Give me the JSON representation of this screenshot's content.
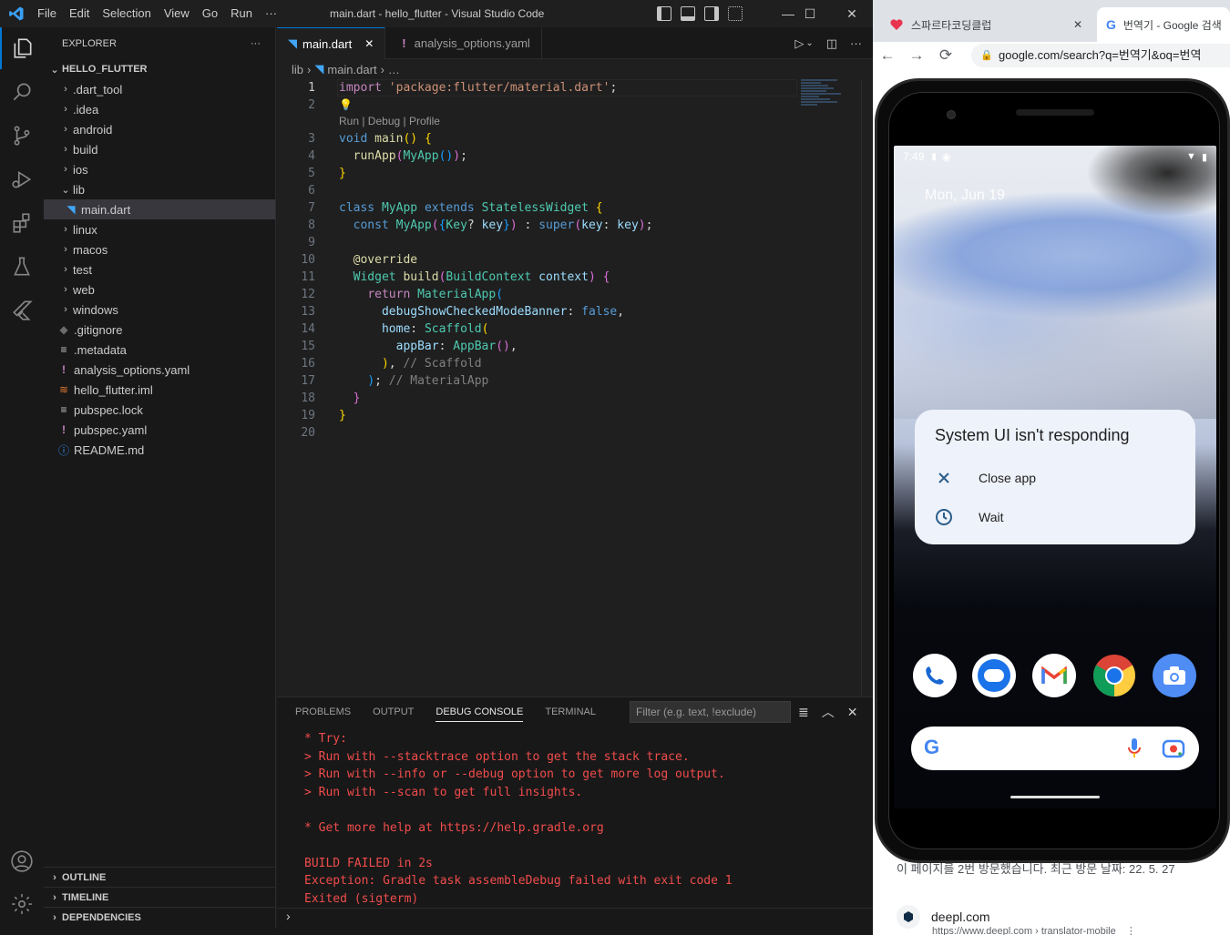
{
  "vscode": {
    "menu": [
      "File",
      "Edit",
      "Selection",
      "View",
      "Go",
      "Run",
      "···"
    ],
    "window_title": "main.dart - hello_flutter - Visual Studio Code",
    "window_controls": {
      "minimize": "—",
      "maximize": "☐",
      "close": "✕"
    },
    "activity_icons": [
      "explorer-icon",
      "search-icon",
      "source-control-icon",
      "run-debug-icon",
      "extensions-icon",
      "testing-icon",
      "flutter-icon",
      "account-icon",
      "settings-gear-icon"
    ],
    "sidebar": {
      "header": "EXPLORER",
      "more": "···",
      "root": "HELLO_FLUTTER",
      "items": [
        {
          "label": ".dart_tool",
          "type": "folder",
          "icon": "›"
        },
        {
          "label": ".idea",
          "type": "folder",
          "icon": "›"
        },
        {
          "label": "android",
          "type": "folder",
          "icon": "›"
        },
        {
          "label": "build",
          "type": "folder",
          "icon": "›"
        },
        {
          "label": "ios",
          "type": "folder",
          "icon": "›"
        },
        {
          "label": "lib",
          "type": "folder-open",
          "icon": "⌄"
        },
        {
          "label": "main.dart",
          "type": "dart",
          "icon": "◥",
          "selected": true
        },
        {
          "label": "linux",
          "type": "folder",
          "icon": "›"
        },
        {
          "label": "macos",
          "type": "folder",
          "icon": "›"
        },
        {
          "label": "test",
          "type": "folder",
          "icon": "›"
        },
        {
          "label": "web",
          "type": "folder",
          "icon": "›"
        },
        {
          "label": "windows",
          "type": "folder",
          "icon": "›"
        },
        {
          "label": ".gitignore",
          "type": "git",
          "icon": "◆"
        },
        {
          "label": ".metadata",
          "type": "text",
          "icon": "≡"
        },
        {
          "label": "analysis_options.yaml",
          "type": "yaml",
          "icon": "!"
        },
        {
          "label": "hello_flutter.iml",
          "type": "rss",
          "icon": "≋"
        },
        {
          "label": "pubspec.lock",
          "type": "text",
          "icon": "≡"
        },
        {
          "label": "pubspec.yaml",
          "type": "yaml",
          "icon": "!"
        },
        {
          "label": "README.md",
          "type": "info",
          "icon": "ⓘ"
        }
      ],
      "sections": [
        "OUTLINE",
        "TIMELINE",
        "DEPENDENCIES"
      ],
      "section_chevron": "›"
    },
    "tabs": [
      {
        "label": "main.dart",
        "icon": "◥",
        "active": true,
        "close": "✕"
      },
      {
        "label": "analysis_options.yaml",
        "icon": "!",
        "active": false
      }
    ],
    "tab_actions": [
      "▷",
      "⌄",
      "◫",
      "···"
    ],
    "breadcrumb": {
      "folder": "lib",
      "sep": "›",
      "icon": "◥",
      "file": "main.dart",
      "rest": "…"
    },
    "codelens": "Run | Debug | Profile",
    "lightbulb": "💡",
    "code_lines": [
      {
        "n": "1",
        "html": "<span class=\"k-purple\">import</span> <span class=\"k-str\">'package:flutter/material.dart'</span>;"
      },
      {
        "n": "2",
        "html": ""
      },
      {
        "n": "3",
        "html": "<span class=\"k-blue\">void</span> <span class=\"k-fn\">main</span><span class=\"k-br1\">()</span> <span class=\"k-br1\">{</span>"
      },
      {
        "n": "4",
        "html": "  <span class=\"k-fn\">runApp</span><span class=\"k-br2\">(</span><span class=\"k-type\">MyApp</span><span class=\"k-br3\">()</span><span class=\"k-br2\">)</span>;"
      },
      {
        "n": "5",
        "html": "<span class=\"k-br1\">}</span>"
      },
      {
        "n": "6",
        "html": ""
      },
      {
        "n": "7",
        "html": "<span class=\"k-blue\">class</span> <span class=\"k-type\">MyApp</span> <span class=\"k-blue\">extends</span> <span class=\"k-type\">StatelessWidget</span> <span class=\"k-br1\">{</span>"
      },
      {
        "n": "8",
        "html": "  <span class=\"k-blue\">const</span> <span class=\"k-type\">MyApp</span><span class=\"k-br2\">(</span><span class=\"k-br3\">{</span><span class=\"k-type\">Key</span>? <span class=\"k-var\">key</span><span class=\"k-br3\">}</span><span class=\"k-br2\">)</span> : <span class=\"k-blue\">super</span><span class=\"k-br2\">(</span><span class=\"k-var\">key</span>: <span class=\"k-var\">key</span><span class=\"k-br2\">)</span>;"
      },
      {
        "n": "9",
        "html": ""
      },
      {
        "n": "10",
        "html": "  <span class=\"k-fn\">@override</span>"
      },
      {
        "n": "11",
        "html": "  <span class=\"k-type\">Widget</span> <span class=\"k-fn\">build</span><span class=\"k-br2\">(</span><span class=\"k-type\">BuildContext</span> <span class=\"k-var\">context</span><span class=\"k-br2\">)</span> <span class=\"k-br2\">{</span>"
      },
      {
        "n": "12",
        "html": "    <span class=\"k-purple\">return</span> <span class=\"k-type\">MaterialApp</span><span class=\"k-br3\">(</span>"
      },
      {
        "n": "13",
        "html": "      <span class=\"k-var\">debugShowCheckedModeBanner</span>: <span class=\"k-blue\">false</span>,"
      },
      {
        "n": "14",
        "html": "      <span class=\"k-var\">home</span>: <span class=\"k-type\">Scaffold</span><span class=\"k-br1\">(</span>"
      },
      {
        "n": "15",
        "html": "        <span class=\"k-var\">appBar</span>: <span class=\"k-type\">AppBar</span><span class=\"k-br2\">()</span>,"
      },
      {
        "n": "16",
        "html": "      <span class=\"k-br1\">)</span>, <span class=\"k-cmt\">// Scaffold</span>"
      },
      {
        "n": "17",
        "html": "    <span class=\"k-br3\">)</span>; <span class=\"k-cmt\">// MaterialApp</span>"
      },
      {
        "n": "18",
        "html": "  <span class=\"k-br2\">}</span>"
      },
      {
        "n": "19",
        "html": "<span class=\"k-br1\">}</span>"
      },
      {
        "n": "20",
        "html": ""
      }
    ],
    "panel": {
      "tabs": [
        "PROBLEMS",
        "OUTPUT",
        "DEBUG CONSOLE",
        "TERMINAL"
      ],
      "active_tab": "DEBUG CONSOLE",
      "filter_placeholder": "Filter (e.g. text, !exclude)",
      "actions": [
        "≣",
        "︿",
        "✕"
      ],
      "console_lines": [
        "* Try:",
        "> Run with --stacktrace option to get the stack trace.",
        "> Run with --info or --debug option to get more log output.",
        "> Run with --scan to get full insights.",
        "",
        "* Get more help at https://help.gradle.org",
        "",
        "BUILD FAILED in 2s",
        "Exception: Gradle task assembleDebug failed with exit code 1",
        "Exited (sigterm)"
      ],
      "prompt": "›"
    },
    "colors": {
      "accent": "#0078d4",
      "error": "#f14c4c"
    }
  },
  "chrome": {
    "tabs": [
      {
        "title": "스파르타코딩클럽",
        "close": "✕"
      },
      {
        "title": "번역기 - Google 검색",
        "icon": "G",
        "active": true
      }
    ],
    "nav": {
      "back": "←",
      "forward": "→",
      "reload": "⟳"
    },
    "url": "google.com/search?q=번역기&oq=번역",
    "page_text": "이 페이지를 2번 방문했습니다. 최근 방문 날짜: 22. 5. 27",
    "result_site": "deepl.com",
    "result_url": "https://www.deepl.com › translator-mobile",
    "result_more": "⋮"
  },
  "android": {
    "time": "7:49",
    "date": "Mon, Jun 19",
    "dialog": {
      "title": "System UI isn't responding",
      "options": [
        {
          "label": "Close app",
          "icon": "close-icon"
        },
        {
          "label": "Wait",
          "icon": "clock-icon"
        }
      ]
    },
    "dock_apps": [
      "phone-icon",
      "messages-icon",
      "gmail-icon",
      "chrome-icon",
      "camera-icon"
    ],
    "search_bar": {
      "logo": "G"
    }
  }
}
